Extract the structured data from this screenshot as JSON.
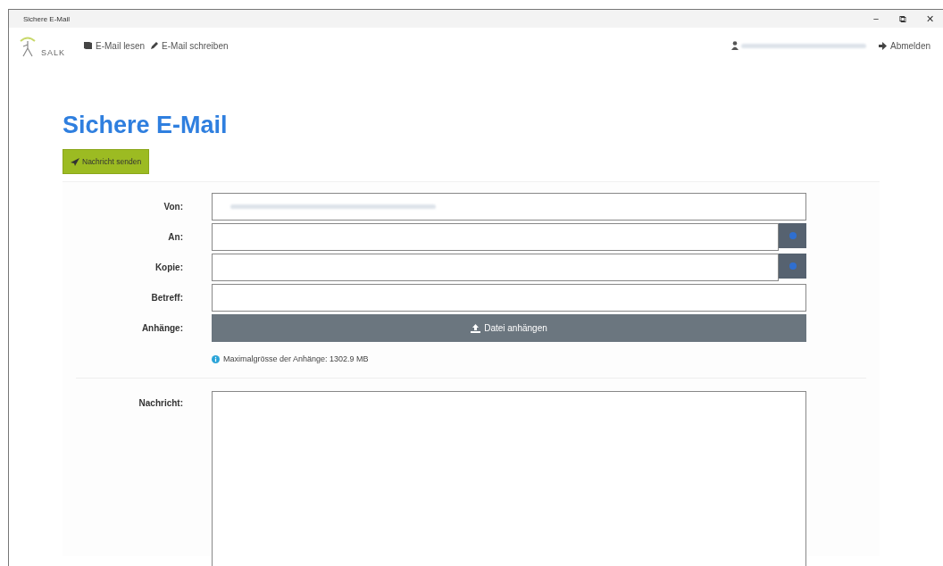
{
  "window": {
    "title": "Sichere E-Mail",
    "controls": [
      "−",
      "⧉",
      "✕"
    ]
  },
  "nav": {
    "brand": "SALK",
    "links": [
      {
        "kind": "read",
        "label": "E-Mail lesen"
      },
      {
        "kind": "write",
        "label": "E-Mail schreiben"
      }
    ],
    "logout": "Abmelden"
  },
  "heading": "Sichere E-Mail",
  "send_button": "Nachricht senden",
  "fields": [
    {
      "kind": "redacted",
      "label": "Von:"
    },
    {
      "kind": "add",
      "label": "An:"
    },
    {
      "kind": "add",
      "label": "Kopie:"
    },
    {
      "kind": "text",
      "label": "Betreff:"
    },
    {
      "kind": "attach",
      "label": "Anhänge:",
      "button": "Datei anhängen"
    }
  ],
  "attachment_info": "Maximalgrösse der Anhänge: 1302.9 MB",
  "message": {
    "label": "Nachricht:"
  }
}
